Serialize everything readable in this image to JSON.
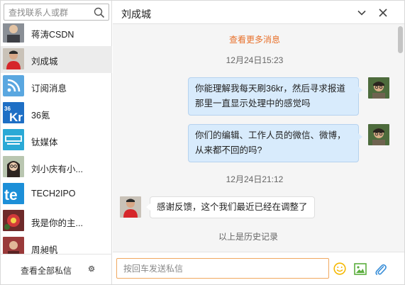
{
  "search": {
    "placeholder": "查找联系人或群"
  },
  "contacts": [
    {
      "name": "蒋涛CSDN",
      "avatar_icon": "person-photo-icon"
    },
    {
      "name": "刘成城",
      "avatar_icon": "person-red-shirt-icon",
      "active": true
    },
    {
      "name": "订阅消息",
      "avatar_icon": "rss-icon"
    },
    {
      "name": "36氪",
      "avatar_icon": "36kr-logo-icon"
    },
    {
      "name": "钛媒体",
      "avatar_icon": "tmtpost-logo-icon"
    },
    {
      "name": "刘小庆有小...",
      "avatar_icon": "person-glasses-icon"
    },
    {
      "name": "TECH2IPO",
      "avatar_icon": "tech2ipo-logo-icon"
    },
    {
      "name": "我是你的主...",
      "avatar_icon": "red-flower-icon"
    },
    {
      "name": "周昶帆",
      "avatar_icon": "person-photo-icon"
    }
  ],
  "sidebar_footer": {
    "view_all_label": "查看全部私信"
  },
  "chat": {
    "title": "刘成城",
    "more_messages_label": "查看更多消息",
    "messages": [
      {
        "type": "timestamp",
        "text": "12月24日15:23"
      },
      {
        "type": "outgoing",
        "text": "你能理解我每天刷36kr，然后寻求报道那里一直显示处理中的感觉吗"
      },
      {
        "type": "outgoing",
        "text": "你们的编辑、工作人员的微信、微博，从来都不回的吗?"
      },
      {
        "type": "timestamp",
        "text": "12月24日21:12"
      },
      {
        "type": "incoming",
        "text": "感谢反馈，这个我们最近已经在调整了"
      }
    ],
    "history_end_label": "以上是历史记录",
    "compose_placeholder": "按回车发送私信"
  },
  "colors": {
    "accent_orange": "#e8702a",
    "outgoing_bubble": "#d8ebfc",
    "active_row": "#ececec",
    "input_border": "#f0a860",
    "icon_green": "#5cae3e",
    "icon_blue": "#3a8fd8",
    "emoji_yellow": "#f5b800"
  }
}
